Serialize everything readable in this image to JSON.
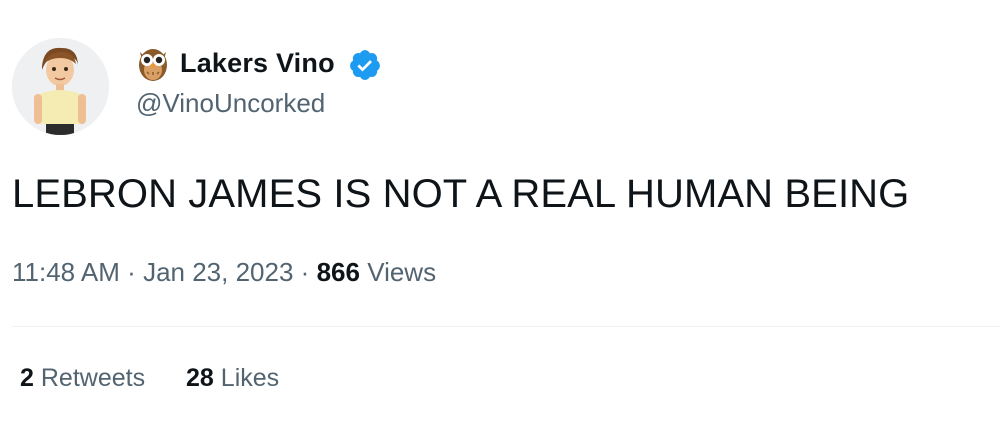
{
  "author": {
    "display_name": "Lakers Vino",
    "handle": "@VinoUncorked",
    "emoji_icon": "owl-emoji-icon",
    "verified_color": "#1d9bf0",
    "avatar": "cartoon-avatar"
  },
  "tweet": {
    "text": "LEBRON JAMES IS NOT A REAL HUMAN BEING"
  },
  "meta": {
    "time": "11:48 AM",
    "separator": "·",
    "date": "Jan 23, 2023",
    "views_count": "866",
    "views_label": "Views"
  },
  "stats": {
    "retweets_count": "2",
    "retweets_label": "Retweets",
    "likes_count": "28",
    "likes_label": "Likes"
  },
  "colors": {
    "text_primary": "#0f1419",
    "text_secondary": "#536471",
    "divider": "#eff3f4"
  }
}
